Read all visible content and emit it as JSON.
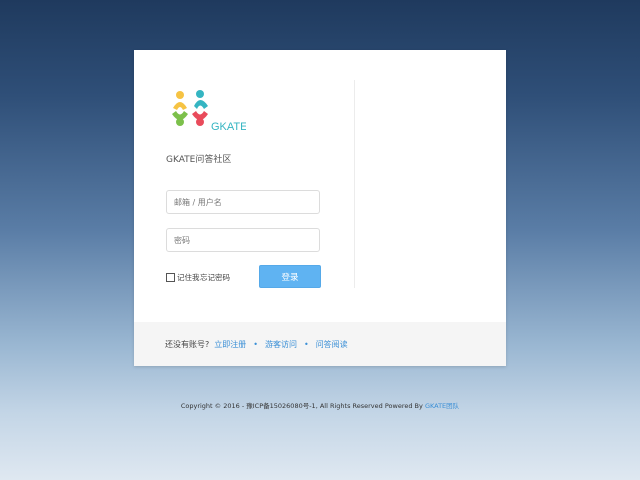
{
  "logo": {
    "text": "GKATE",
    "colors": [
      "#f6c343",
      "#35b5c2",
      "#e94b5b",
      "#7cc04b"
    ]
  },
  "community_title": "GKATE问答社区",
  "email_input": {
    "value": "",
    "placeholder": "邮箱 / 用户名"
  },
  "password_input": {
    "value": "",
    "placeholder": "密码"
  },
  "remember_label": "记住我",
  "forgot_label": "忘记密码",
  "login_label": "登录",
  "footer": {
    "question": "还没有账号?",
    "register": "立即注册",
    "guest": "游客访问",
    "guide": "问答阅读",
    "separator": "•"
  },
  "copyright": {
    "text": "Copyright © 2016 - 豫ICP备15026080号-1, All Rights Reserved Powered By",
    "link": "GKATE团队"
  },
  "colors": {
    "accent": "#5fb3f2",
    "link": "#3a8fd6"
  }
}
